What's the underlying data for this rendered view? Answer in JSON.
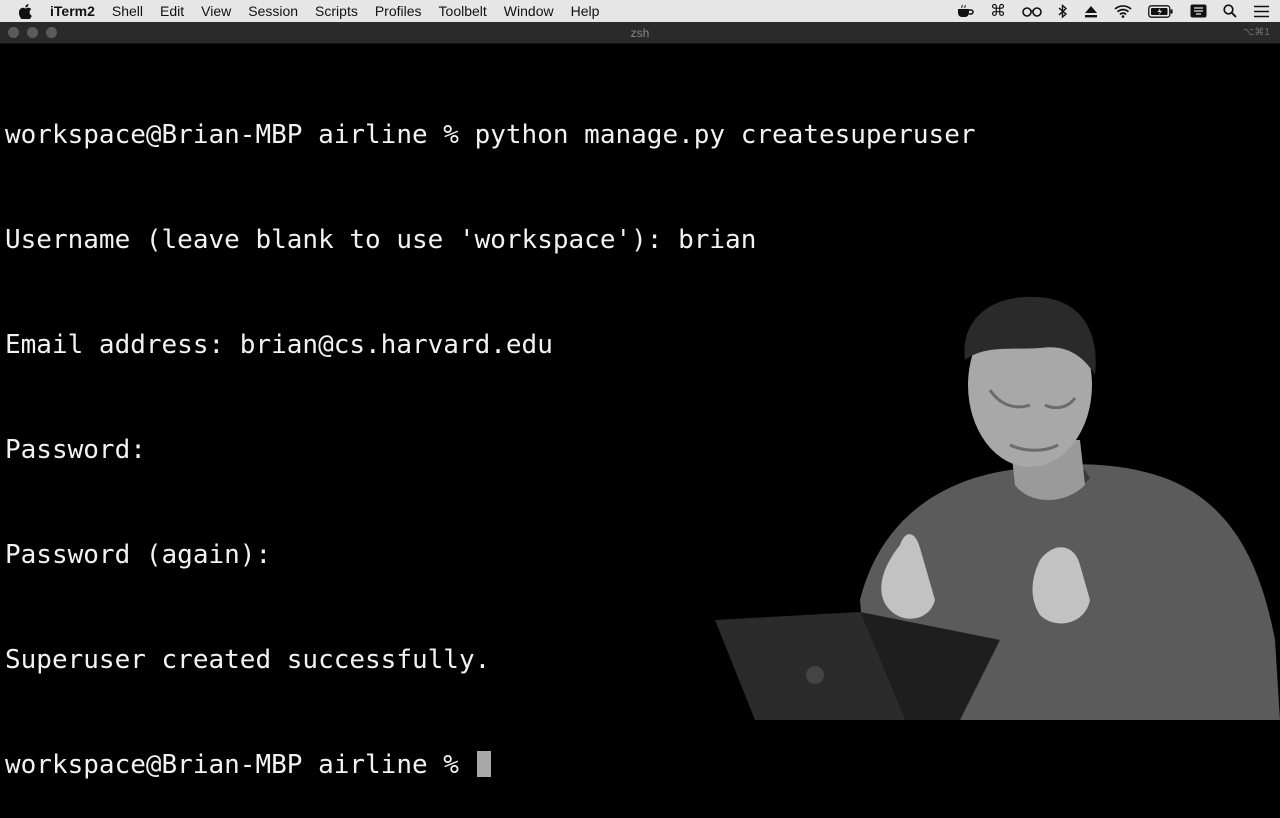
{
  "menubar": {
    "app_name": "iTerm2",
    "items": [
      "Shell",
      "Edit",
      "View",
      "Session",
      "Scripts",
      "Profiles",
      "Toolbelt",
      "Window",
      "Help"
    ],
    "status_icons": [
      "tea-icon",
      "command-icon",
      "glasses-icon",
      "bluetooth-icon",
      "eject-icon",
      "wifi-icon",
      "battery-icon",
      "keyboard-input-icon",
      "search-icon",
      "menu-list-icon"
    ]
  },
  "window": {
    "title": "zsh",
    "shortcut": "⌥⌘1"
  },
  "terminal": {
    "lines": [
      "workspace@Brian-MBP airline % python manage.py createsuperuser",
      "Username (leave blank to use 'workspace'): brian",
      "Email address: brian@cs.harvard.edu",
      "Password:",
      "Password (again):",
      "Superuser created successfully.",
      "workspace@Brian-MBP airline % "
    ]
  },
  "colors": {
    "terminal_bg": "#000000",
    "terminal_fg": "#f2f2f2",
    "menubar_bg": "#e6e6e6",
    "titlebar_bg": "#2a2a2a",
    "cursor": "#a8a8a8"
  }
}
